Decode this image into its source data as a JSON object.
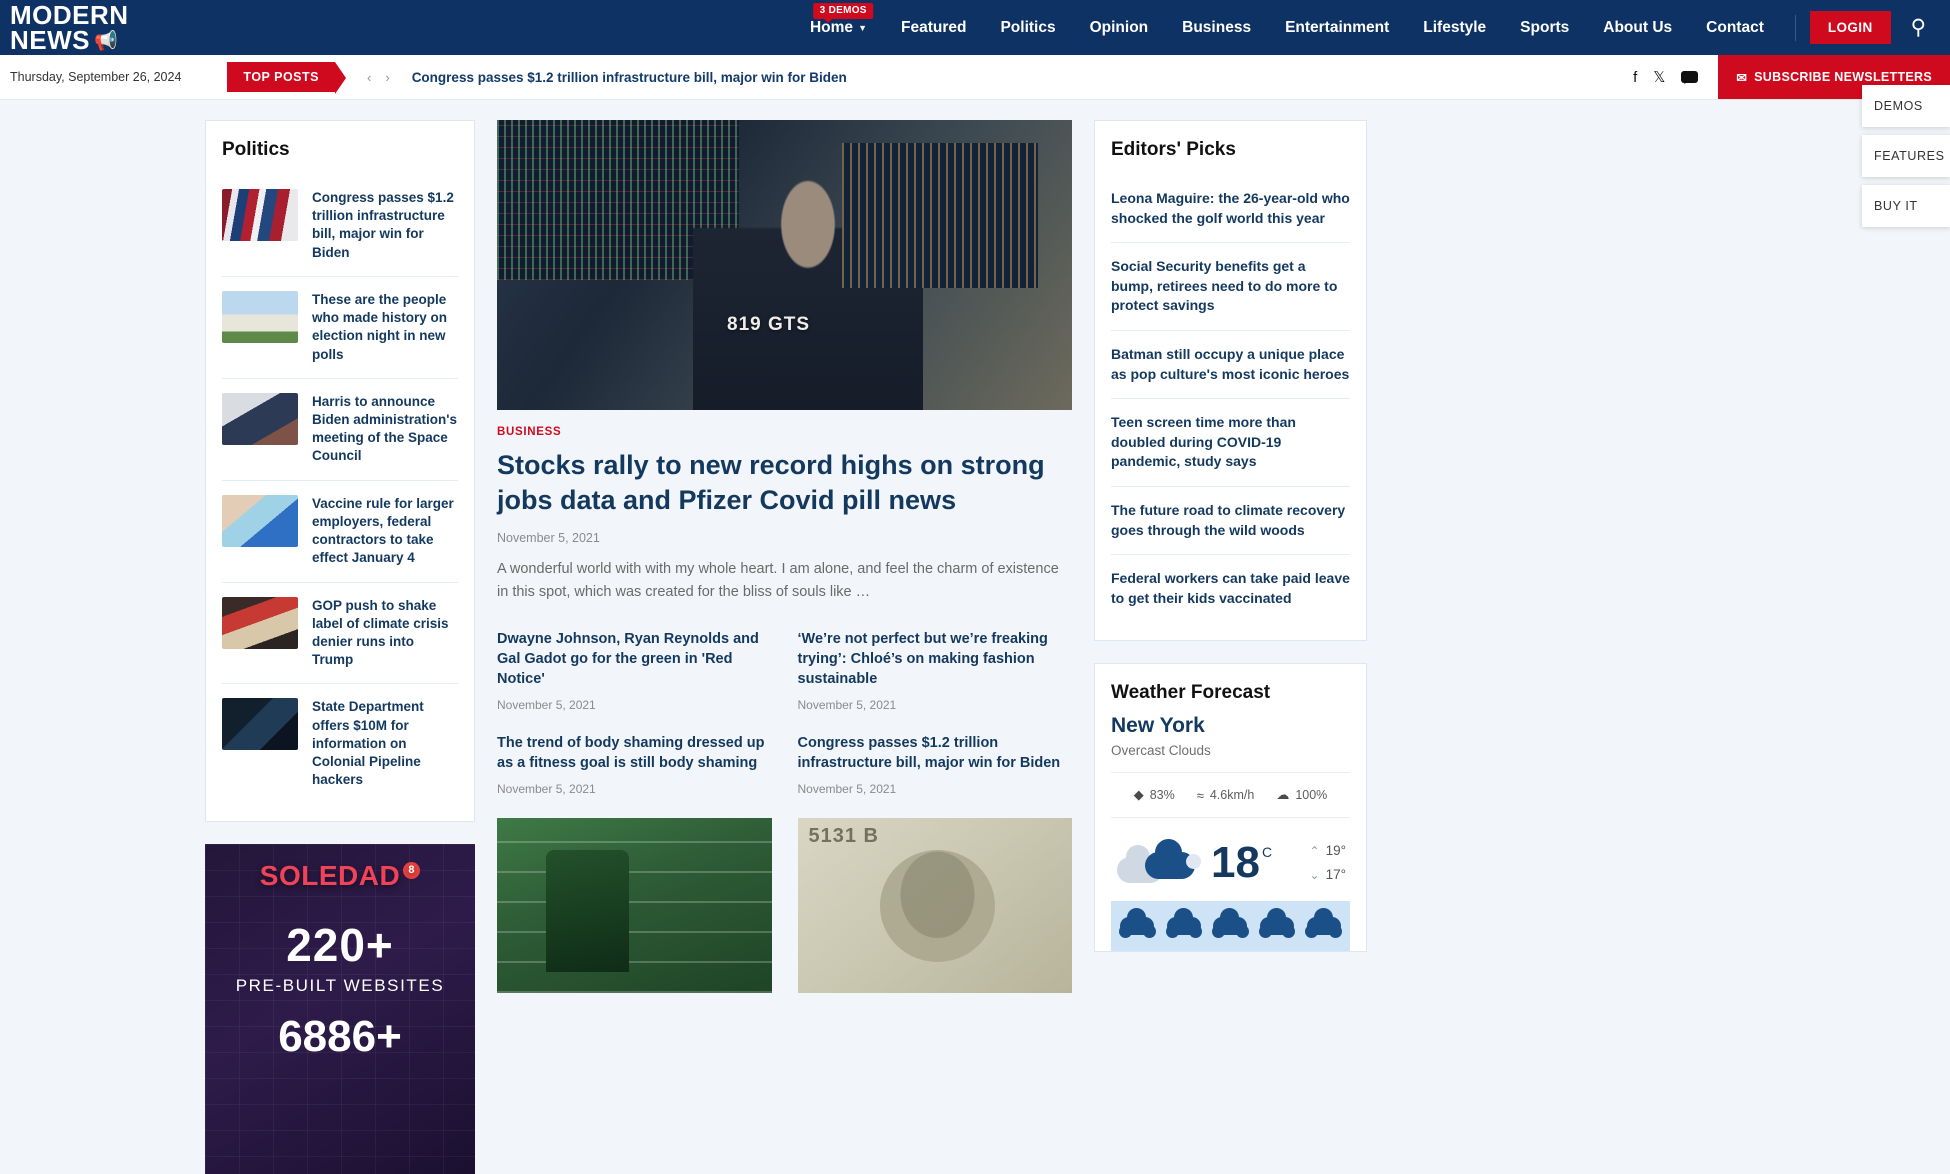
{
  "brand": {
    "line1": "MODERN",
    "line2": "NEWS",
    "icon": "megaphone-icon"
  },
  "colors": {
    "navy": "#0d3263",
    "red": "#d00a1e",
    "link": "#14395f"
  },
  "nav": {
    "items": [
      {
        "label": "Home",
        "badge": "3 DEMOS",
        "caret": "⌄"
      },
      {
        "label": "Featured"
      },
      {
        "label": "Politics"
      },
      {
        "label": "Opinion"
      },
      {
        "label": "Business"
      },
      {
        "label": "Entertainment"
      },
      {
        "label": "Lifestyle"
      },
      {
        "label": "Sports"
      },
      {
        "label": "About Us"
      },
      {
        "label": "Contact"
      }
    ],
    "login_label": "LOGIN",
    "search_icon": "search-icon"
  },
  "subbar": {
    "date": "Thursday, September 26, 2024",
    "top_posts_label": "TOP POSTS",
    "prev_icon": "‹",
    "next_icon": "›",
    "ticker_headline": "Congress passes $1.2 trillion infrastructure bill, major win for Biden",
    "social": [
      {
        "name": "facebook-icon",
        "glyph": "f"
      },
      {
        "name": "x-twitter-icon",
        "glyph": "𝕏"
      },
      {
        "name": "youtube-icon",
        "glyph": "▶"
      }
    ],
    "subscribe_label": "SUBSCRIBE NEWSLETTERS",
    "subscribe_icon": "✉"
  },
  "float_panel": [
    {
      "label": "DEMOS"
    },
    {
      "label": "FEATURES"
    },
    {
      "label": "BUY IT"
    }
  ],
  "politics": {
    "title": "Politics",
    "items": [
      {
        "title": "Congress passes $1.2 trillion infrastructure bill, major win for Biden",
        "thumb": "biden-flags"
      },
      {
        "title": "These are the people who made history on election night in new polls",
        "thumb": "capitol"
      },
      {
        "title": "Harris to announce Biden administration's meeting of the Space Council",
        "thumb": "harris"
      },
      {
        "title": "Vaccine rule for larger employers, federal contractors to take effect January 4",
        "thumb": "vaccine"
      },
      {
        "title": "GOP push to shake label of climate crisis denier runs into Trump",
        "thumb": "trump"
      },
      {
        "title": "State Department offers $10M for information on Colonial Pipeline hackers",
        "thumb": "laptop"
      }
    ]
  },
  "promo": {
    "brand": "SOLEDAD",
    "sup": "8",
    "number": "220+",
    "subtitle": "PRE-BUILT WEBSITES",
    "number2": "6886+"
  },
  "feature": {
    "category": "BUSINESS",
    "title": "Stocks rally to new record highs on strong jobs data and Pfizer Covid pill news",
    "date": "November 5, 2021",
    "excerpt": "A wonderful world with with my whole heart. I am alone, and feel the charm of existence in this spot, which was created for the bliss of souls like …",
    "hero_badge": "819 GTS",
    "sub_articles": [
      {
        "title": "Dwayne Johnson, Ryan Reynolds and Gal Gadot go for the green in 'Red Notice'",
        "date": "November 5, 2021"
      },
      {
        "title": "‘We’re not perfect but we’re freaking trying’: Chloé’s on making fashion sustainable",
        "date": "November 5, 2021"
      },
      {
        "title": "The trend of body shaming dressed up as a fitness goal is still body shaming",
        "date": "November 5, 2021"
      },
      {
        "title": "Congress passes $1.2 trillion infrastructure bill, major win for Biden",
        "date": "November 5, 2021"
      }
    ],
    "bottom_images": [
      {
        "name": "football-photo"
      },
      {
        "name": "hundred-dollar-bill-photo",
        "caption": "5131 B"
      }
    ]
  },
  "editors_picks": {
    "title": "Editors' Picks",
    "items": [
      {
        "title": "Leona Maguire: the 26-year-old who shocked the golf world this year"
      },
      {
        "title": "Social Security benefits get a bump, retirees need to do more to protect savings"
      },
      {
        "title": "Batman still occupy a unique place as pop culture's most iconic heroes"
      },
      {
        "title": "Teen screen time more than doubled during COVID-19 pandemic, study says"
      },
      {
        "title": "The future road to climate recovery goes through the wild woods"
      },
      {
        "title": "Federal workers can take paid leave to get their kids vaccinated"
      }
    ]
  },
  "weather": {
    "title": "Weather Forecast",
    "city": "New York",
    "condition": "Overcast Clouds",
    "stats": [
      {
        "icon": "humidity-droplet-icon",
        "glyph": "◆",
        "value": "83%"
      },
      {
        "icon": "wind-icon",
        "glyph": "≈",
        "value": "4.6km/h"
      },
      {
        "icon": "cloud-cover-icon",
        "glyph": "☁",
        "value": "100%"
      }
    ],
    "temp": "18",
    "unit": "C",
    "high": "19°",
    "low": "17°",
    "high_arrow": "⌃",
    "low_arrow": "⌄",
    "forecast": [
      {
        "icon": "rain-cloud-icon"
      },
      {
        "icon": "rain-cloud-icon"
      },
      {
        "icon": "rain-cloud-icon"
      },
      {
        "icon": "rain-cloud-icon"
      },
      {
        "icon": "rain-cloud-icon"
      }
    ]
  }
}
